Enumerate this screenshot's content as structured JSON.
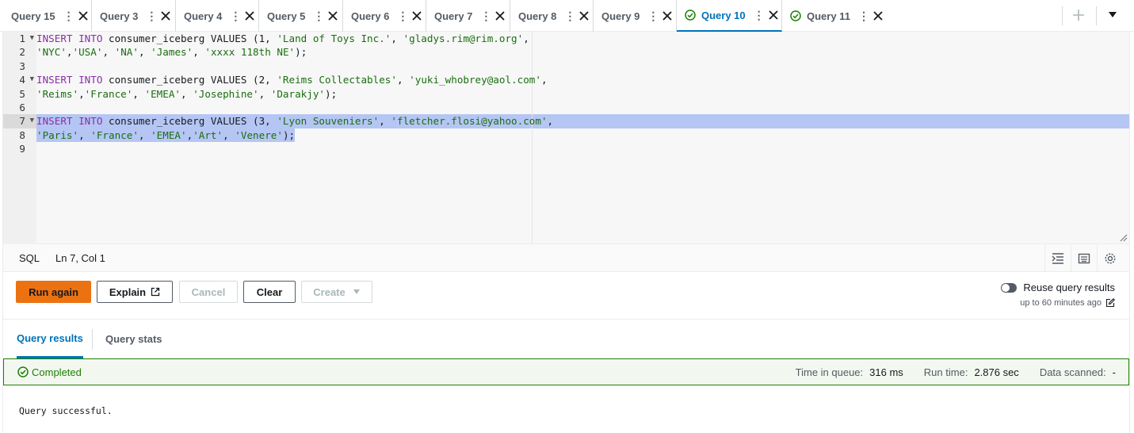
{
  "tabs": [
    {
      "label": "Query 15",
      "status": "none"
    },
    {
      "label": "Query 3",
      "status": "none"
    },
    {
      "label": "Query 4",
      "status": "none"
    },
    {
      "label": "Query 5",
      "status": "none"
    },
    {
      "label": "Query 6",
      "status": "none"
    },
    {
      "label": "Query 7",
      "status": "none"
    },
    {
      "label": "Query 8",
      "status": "none"
    },
    {
      "label": "Query 9",
      "status": "none"
    },
    {
      "label": "Query 10",
      "status": "success",
      "active": true
    },
    {
      "label": "Query 11",
      "status": "success"
    }
  ],
  "editor": {
    "line_numbers": [
      "1",
      "2",
      "3",
      "4",
      "5",
      "6",
      "7",
      "8",
      "9"
    ],
    "active_line": 7,
    "selected_lines": [
      7,
      8
    ],
    "lines": [
      "INSERT INTO consumer_iceberg VALUES (1, 'Land of Toys Inc.', 'gladys.rim@rim.org',",
      "'NYC','USA', 'NA', 'James', 'xxxx 118th NE');",
      "",
      "INSERT INTO consumer_iceberg VALUES (2, 'Reims Collectables', 'yuki_whobrey@aol.com',",
      "'Reims','France', 'EMEA', 'Josephine', 'Darakjy');",
      "",
      "INSERT INTO consumer_iceberg VALUES (3, 'Lyon Souveniers', 'fletcher.flosi@yahoo.com',",
      "'Paris', 'France', 'EMEA','Art', 'Venere');",
      ""
    ]
  },
  "statusbar": {
    "language": "SQL",
    "cursor": "Ln 7, Col 1"
  },
  "actions": {
    "run_again": "Run again",
    "explain": "Explain",
    "cancel": "Cancel",
    "clear": "Clear",
    "create": "Create",
    "reuse_label": "Reuse query results",
    "reuse_sub": "up to 60 minutes ago",
    "reuse_enabled": false
  },
  "result_tabs": {
    "results": "Query results",
    "stats": "Query stats"
  },
  "banner": {
    "status": "Completed",
    "queue_label": "Time in queue:",
    "queue_value": "316 ms",
    "run_label": "Run time:",
    "run_value": "2.876 sec",
    "scanned_label": "Data scanned:",
    "scanned_value": "-"
  },
  "result_message": "Query successful.",
  "colors": {
    "accent": "#0073bb",
    "primary_button": "#ec7211",
    "success": "#1d8102",
    "selection": "#b5c6f4",
    "keyword": "#8a2fa3",
    "string": "#1a6e10"
  }
}
